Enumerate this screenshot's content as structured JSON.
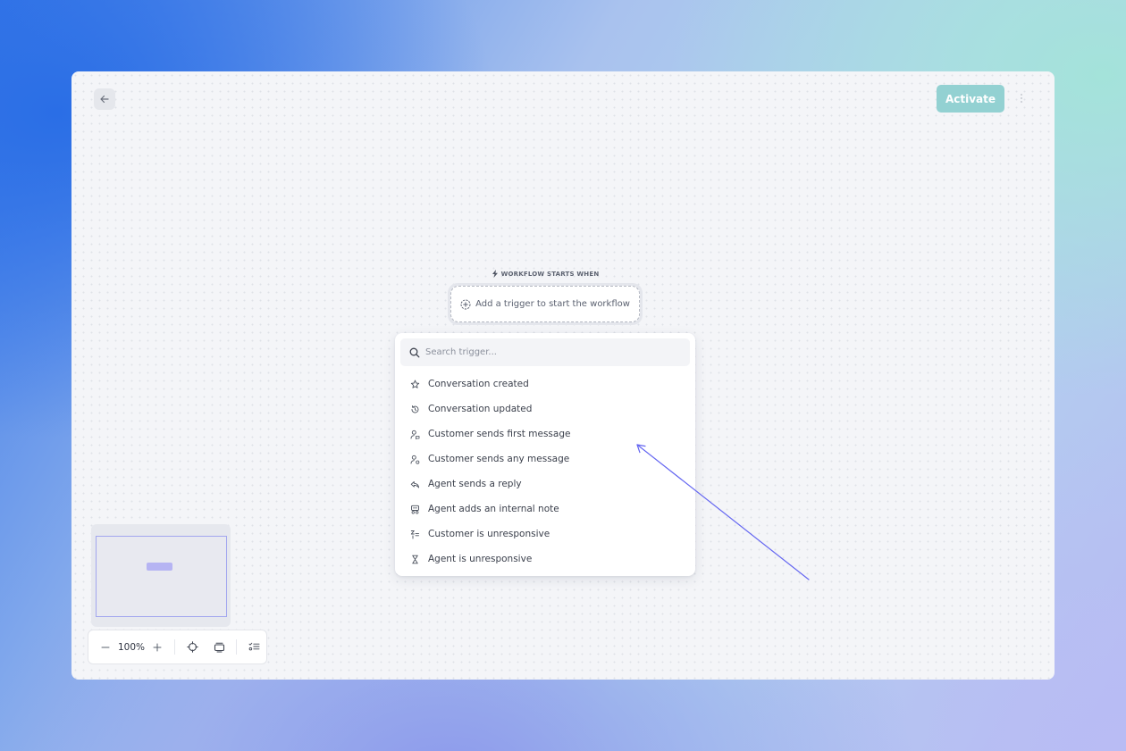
{
  "header": {
    "back_icon": "arrow-left-icon",
    "activate_label": "Activate",
    "more_icon": "more-vertical-icon"
  },
  "canvas": {
    "trigger_label": "WORKFLOW STARTS WHEN",
    "trigger_label_icon": "lightning-icon",
    "trigger_placeholder": "Add a trigger to start the workflow",
    "trigger_icon": "plus-circle-icon"
  },
  "dropdown": {
    "search_placeholder": "Search trigger...",
    "items": [
      {
        "label": "Conversation created",
        "icon": "sparkle-star-icon"
      },
      {
        "label": "Conversation updated",
        "icon": "refresh-icon"
      },
      {
        "label": "Customer sends first message",
        "icon": "user-message-icon"
      },
      {
        "label": "Customer sends any message",
        "icon": "user-message-icon"
      },
      {
        "label": "Agent sends a reply",
        "icon": "reply-icon"
      },
      {
        "label": "Agent adds an internal note",
        "icon": "note-icon"
      },
      {
        "label": "Customer is unresponsive",
        "icon": "sleep-icon"
      },
      {
        "label": "Agent is unresponsive",
        "icon": "hourglass-icon"
      }
    ]
  },
  "zoom": {
    "value": "100%",
    "minus_icon": "minus-icon",
    "plus_icon": "plus-icon",
    "fit_icon": "crosshair-icon",
    "layout_icon": "layers-icon",
    "list_icon": "list-check-icon"
  },
  "colors": {
    "activate_bg": "#93d1d2",
    "accent": "#6466f1",
    "canvas_bg": "#f4f5f8"
  }
}
